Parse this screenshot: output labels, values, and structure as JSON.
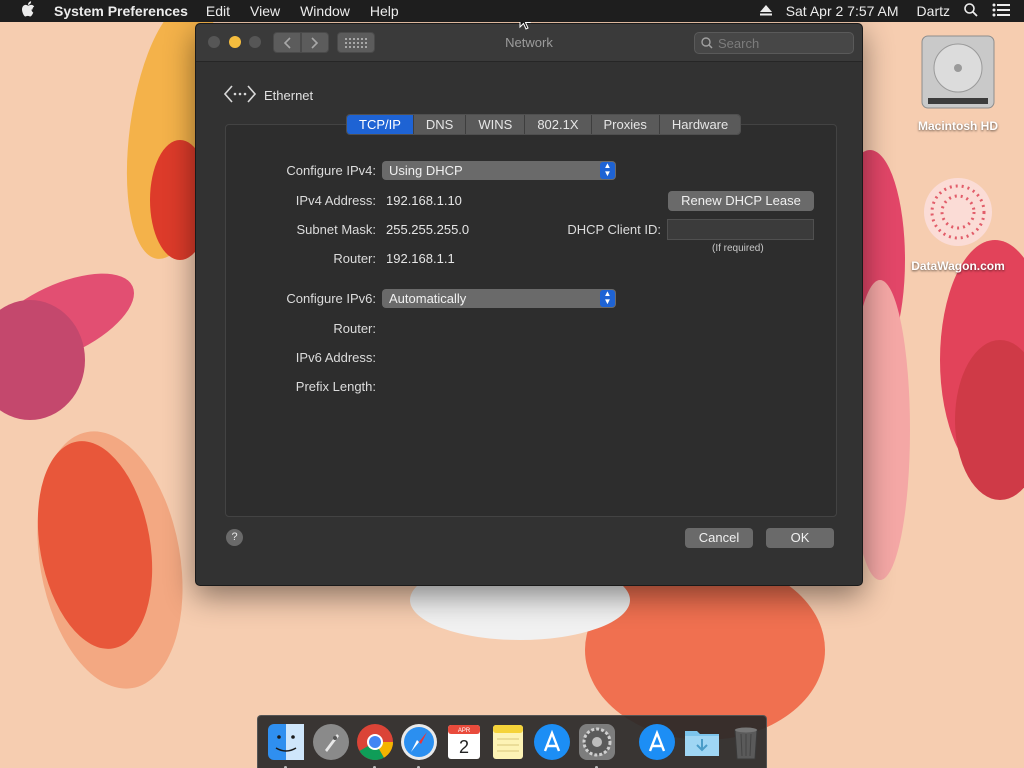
{
  "menubar": {
    "app_name": "System Preferences",
    "menus": [
      "Edit",
      "View",
      "Window",
      "Help"
    ],
    "datetime": "Sat Apr 2  7:57 AM",
    "user": "Dartz"
  },
  "desktop": {
    "icons": [
      {
        "label": "Macintosh HD",
        "icon": "hard-drive-icon"
      },
      {
        "label": "DataWagon.com",
        "icon": "datawagon-icon"
      }
    ]
  },
  "window": {
    "title": "Network",
    "search_placeholder": "Search",
    "interface_name": "Ethernet",
    "tabs": [
      {
        "label": "TCP/IP",
        "active": true
      },
      {
        "label": "DNS",
        "active": false
      },
      {
        "label": "WINS",
        "active": false
      },
      {
        "label": "802.1X",
        "active": false
      },
      {
        "label": "Proxies",
        "active": false
      },
      {
        "label": "Hardware",
        "active": false
      }
    ],
    "tcpip": {
      "configure_ipv4_label": "Configure IPv4:",
      "configure_ipv4_value": "Using DHCP",
      "ipv4_address_label": "IPv4 Address:",
      "ipv4_address_value": "192.168.1.10",
      "subnet_mask_label": "Subnet Mask:",
      "subnet_mask_value": "255.255.255.0",
      "router_label": "Router:",
      "router_value": "192.168.1.1",
      "renew_button": "Renew DHCP Lease",
      "dhcp_client_id_label": "DHCP Client ID:",
      "dhcp_client_id_value": "",
      "dhcp_client_id_hint": "(If required)",
      "configure_ipv6_label": "Configure IPv6:",
      "configure_ipv6_value": "Automatically",
      "router6_label": "Router:",
      "ipv6_address_label": "IPv6 Address:",
      "prefix_length_label": "Prefix Length:"
    },
    "help_label": "?",
    "cancel_button": "Cancel",
    "ok_button": "OK"
  },
  "dock": {
    "items": [
      "finder-icon",
      "launchpad-icon",
      "chrome-icon",
      "safari-icon",
      "calendar-icon",
      "notes-icon",
      "app-store-icon",
      "system-preferences-icon",
      "app-store-folder-icon",
      "downloads-folder-icon",
      "trash-icon"
    ],
    "calendar_month": "APR",
    "calendar_day": "2"
  },
  "colors": {
    "accent": "#1e63d4",
    "window_bg": "#323232",
    "wallpaper": "#f6cdb0"
  }
}
